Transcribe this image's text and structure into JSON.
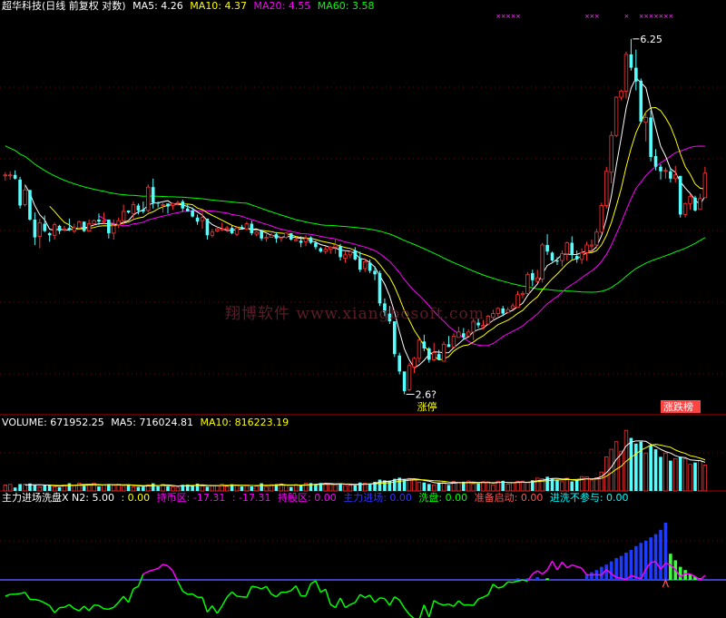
{
  "price_panel": {
    "title": "超华科技(日线 前复权 对数)",
    "legend": [
      {
        "label": "MA5: 4.26",
        "color": "#ffffff"
      },
      {
        "label": "MA10: 4.37",
        "color": "#ffff00"
      },
      {
        "label": "MA20: 4.55",
        "color": "#ff00ff"
      },
      {
        "label": "MA60: 3.58",
        "color": "#00ff00"
      }
    ],
    "high_label": "6.25",
    "low_label": "2.6?",
    "low_tag": "涨停",
    "high_tag": "涨跌榜",
    "watermark": "翔博软件 www.xiangbosoft.com"
  },
  "volume_panel": {
    "legend": [
      {
        "label": "VOLUME: 671952.25",
        "color": "#ffffff"
      },
      {
        "label": "MA5: 716024.81",
        "color": "#ffffff"
      },
      {
        "label": "MA10: 816223.19",
        "color": "#ffff00"
      }
    ]
  },
  "indicator_panel": {
    "legend": [
      {
        "label": "主力进场洗盘X  N2: 5.00",
        "color": "#ffffff"
      },
      {
        "label": ": 0.00",
        "color": "#ffff00"
      },
      {
        "label": "持币区: -17.31",
        "color": "#ff00ff"
      },
      {
        "label": ": -17.31",
        "color": "#ff00ff"
      },
      {
        "label": "持股区: 0.00",
        "color": "#ff00ff"
      },
      {
        "label": "主力进场: 0.00",
        "color": "#3333ff"
      },
      {
        "label": "洗盘: 0.00",
        "color": "#00ff00"
      },
      {
        "label": "准备启动: 0.00",
        "color": "#ff5555"
      },
      {
        "label": "进洗不参与: 0.00",
        "color": "#00ffff"
      }
    ]
  },
  "colors": {
    "up": "#ff3333",
    "down": "#54ffff",
    "ma5": "#ffffff",
    "ma10": "#ffff00",
    "ma20": "#ff00ff",
    "ma60": "#00ff00",
    "grid": "#7a0000",
    "blue_bar": "#1e3cff",
    "green_bar": "#3cff3c"
  },
  "chart_data": {
    "type": "candlestick",
    "scale": "log",
    "y_range": [
      2.55,
      6.6
    ],
    "ohlc": [
      [
        4.49,
        4.53,
        4.44,
        4.5
      ],
      [
        4.5,
        4.54,
        4.45,
        4.5
      ],
      [
        4.5,
        4.55,
        4.45,
        4.46
      ],
      [
        4.45,
        4.48,
        4.15,
        4.18
      ],
      [
        4.19,
        4.38,
        4.17,
        4.34
      ],
      [
        4.34,
        4.34,
        4.03,
        4.04
      ],
      [
        4.04,
        4.11,
        3.8,
        3.87
      ],
      [
        3.88,
        4.05,
        3.77,
        4.01
      ],
      [
        4.0,
        4.08,
        3.92,
        3.93
      ],
      [
        3.91,
        3.92,
        3.83,
        3.89
      ],
      [
        3.89,
        4.01,
        3.85,
        3.99
      ],
      [
        3.98,
        3.99,
        3.9,
        3.93
      ],
      [
        3.94,
        3.98,
        3.93,
        3.95
      ],
      [
        3.96,
        4.05,
        3.93,
        3.94
      ],
      [
        3.93,
        4.0,
        3.91,
        3.96
      ],
      [
        3.96,
        4.03,
        3.95,
        4.02
      ],
      [
        4.02,
        4.02,
        3.92,
        3.93
      ],
      [
        3.93,
        4.04,
        3.93,
        4.0
      ],
      [
        4.0,
        4.04,
        3.98,
        4.03
      ],
      [
        4.04,
        4.1,
        3.99,
        4.02
      ],
      [
        4.02,
        4.11,
        4.0,
        4.03
      ],
      [
        4.04,
        4.04,
        3.86,
        3.91
      ],
      [
        3.91,
        4.04,
        3.85,
        3.98
      ],
      [
        3.99,
        4.06,
        3.96,
        4.03
      ],
      [
        4.03,
        4.19,
        3.99,
        4.12
      ],
      [
        4.13,
        4.13,
        4.1,
        4.11
      ],
      [
        4.1,
        4.22,
        4.05,
        4.19
      ],
      [
        4.18,
        4.2,
        4.09,
        4.13
      ],
      [
        4.14,
        4.22,
        4.1,
        4.12
      ],
      [
        4.13,
        4.4,
        4.11,
        4.37
      ],
      [
        4.37,
        4.46,
        4.15,
        4.21
      ],
      [
        4.21,
        4.22,
        4.16,
        4.2
      ],
      [
        4.19,
        4.23,
        4.11,
        4.19
      ],
      [
        4.2,
        4.2,
        4.1,
        4.17
      ],
      [
        4.18,
        4.21,
        4.14,
        4.2
      ],
      [
        4.2,
        4.23,
        4.18,
        4.21
      ],
      [
        4.22,
        4.24,
        4.12,
        4.15
      ],
      [
        4.15,
        4.19,
        4.12,
        4.12
      ],
      [
        4.13,
        4.16,
        4.06,
        4.07
      ],
      [
        4.06,
        4.09,
        3.99,
        4.02
      ],
      [
        4.03,
        4.11,
        3.95,
        4.06
      ],
      [
        4.05,
        4.05,
        3.85,
        3.89
      ],
      [
        3.89,
        3.95,
        3.87,
        3.92
      ],
      [
        3.93,
        3.98,
        3.92,
        3.95
      ],
      [
        3.95,
        4.01,
        3.93,
        3.95
      ],
      [
        3.95,
        3.98,
        3.92,
        3.96
      ],
      [
        3.96,
        3.99,
        3.9,
        3.91
      ],
      [
        3.9,
        3.97,
        3.88,
        3.96
      ],
      [
        3.97,
        3.99,
        3.95,
        3.96
      ],
      [
        3.95,
        4.02,
        3.94,
        4.0
      ],
      [
        4.0,
        4.03,
        3.89,
        3.91
      ],
      [
        3.9,
        3.93,
        3.88,
        3.92
      ],
      [
        3.93,
        3.94,
        3.84,
        3.86
      ],
      [
        3.86,
        3.9,
        3.83,
        3.87
      ],
      [
        3.87,
        3.91,
        3.87,
        3.89
      ],
      [
        3.9,
        3.92,
        3.82,
        3.86
      ],
      [
        3.86,
        3.87,
        3.83,
        3.87
      ],
      [
        3.87,
        3.92,
        3.86,
        3.91
      ],
      [
        3.91,
        3.91,
        3.84,
        3.85
      ],
      [
        3.84,
        3.87,
        3.83,
        3.85
      ],
      [
        3.84,
        3.88,
        3.78,
        3.82
      ],
      [
        3.83,
        3.89,
        3.79,
        3.86
      ],
      [
        3.87,
        3.88,
        3.81,
        3.82
      ],
      [
        3.82,
        3.84,
        3.76,
        3.78
      ],
      [
        3.77,
        3.78,
        3.73,
        3.74
      ],
      [
        3.74,
        3.79,
        3.72,
        3.76
      ],
      [
        3.76,
        3.79,
        3.72,
        3.78
      ],
      [
        3.78,
        3.85,
        3.72,
        3.8
      ],
      [
        3.79,
        3.81,
        3.66,
        3.69
      ],
      [
        3.68,
        3.74,
        3.64,
        3.71
      ],
      [
        3.71,
        3.75,
        3.68,
        3.74
      ],
      [
        3.75,
        3.78,
        3.66,
        3.67
      ],
      [
        3.68,
        3.74,
        3.56,
        3.58
      ],
      [
        3.59,
        3.68,
        3.56,
        3.65
      ],
      [
        3.64,
        3.67,
        3.55,
        3.57
      ],
      [
        3.57,
        3.61,
        3.49,
        3.54
      ],
      [
        3.55,
        3.57,
        3.28,
        3.3
      ],
      [
        3.3,
        3.34,
        3.2,
        3.23
      ],
      [
        3.22,
        3.28,
        3.14,
        3.16
      ],
      [
        3.16,
        3.16,
        2.9,
        2.92
      ],
      [
        2.91,
        2.93,
        2.78,
        2.8
      ],
      [
        2.8,
        2.8,
        2.65,
        2.67
      ],
      [
        2.68,
        2.86,
        2.67,
        2.84
      ],
      [
        2.83,
        2.9,
        2.79,
        2.89
      ],
      [
        2.89,
        3.03,
        2.86,
        3.02
      ],
      [
        3.01,
        3.06,
        2.94,
        2.96
      ],
      [
        2.96,
        2.97,
        2.86,
        2.88
      ],
      [
        2.88,
        3.0,
        2.87,
        2.93
      ],
      [
        2.92,
        2.95,
        2.88,
        2.88
      ],
      [
        2.87,
        3.01,
        2.87,
        2.99
      ],
      [
        2.99,
        3.05,
        2.97,
        2.97
      ],
      [
        2.97,
        3.07,
        2.97,
        3.05
      ],
      [
        3.04,
        3.12,
        3.04,
        3.08
      ],
      [
        3.07,
        3.11,
        3.02,
        3.04
      ],
      [
        3.05,
        3.1,
        3.05,
        3.08
      ],
      [
        3.08,
        3.18,
        3.02,
        3.16
      ],
      [
        3.15,
        3.18,
        3.11,
        3.13
      ],
      [
        3.12,
        3.17,
        3.1,
        3.13
      ],
      [
        3.14,
        3.21,
        3.13,
        3.2
      ],
      [
        3.19,
        3.25,
        3.16,
        3.22
      ],
      [
        3.22,
        3.27,
        3.2,
        3.26
      ],
      [
        3.26,
        3.28,
        3.2,
        3.22
      ],
      [
        3.23,
        3.27,
        3.22,
        3.25
      ],
      [
        3.26,
        3.3,
        3.25,
        3.28
      ],
      [
        3.27,
        3.4,
        3.27,
        3.37
      ],
      [
        3.37,
        3.4,
        3.34,
        3.38
      ],
      [
        3.38,
        3.56,
        3.37,
        3.54
      ],
      [
        3.55,
        3.58,
        3.44,
        3.49
      ],
      [
        3.48,
        3.58,
        3.47,
        3.51
      ],
      [
        3.5,
        3.82,
        3.47,
        3.8
      ],
      [
        3.8,
        3.9,
        3.71,
        3.74
      ],
      [
        3.73,
        3.74,
        3.65,
        3.66
      ],
      [
        3.66,
        3.69,
        3.62,
        3.65
      ],
      [
        3.66,
        3.75,
        3.61,
        3.72
      ],
      [
        3.72,
        3.83,
        3.66,
        3.82
      ],
      [
        3.82,
        3.88,
        3.67,
        3.71
      ],
      [
        3.7,
        3.75,
        3.64,
        3.67
      ],
      [
        3.67,
        3.77,
        3.63,
        3.73
      ],
      [
        3.73,
        3.83,
        3.66,
        3.8
      ],
      [
        3.79,
        3.85,
        3.74,
        3.8
      ],
      [
        3.8,
        3.95,
        3.77,
        3.92
      ],
      [
        3.92,
        4.21,
        3.91,
        4.18
      ],
      [
        4.18,
        4.59,
        4.15,
        4.54
      ],
      [
        4.53,
        5.0,
        4.41,
        4.95
      ],
      [
        4.95,
        5.44,
        4.93,
        5.43
      ],
      [
        5.43,
        5.53,
        5.39,
        5.51
      ],
      [
        5.51,
        6.06,
        5.41,
        6.02
      ],
      [
        6.02,
        6.25,
        5.79,
        5.83
      ],
      [
        5.83,
        6.09,
        5.52,
        5.64
      ],
      [
        5.65,
        5.68,
        5.1,
        5.12
      ],
      [
        5.11,
        5.24,
        4.88,
        5.17
      ],
      [
        5.17,
        5.26,
        4.65,
        4.7
      ],
      [
        4.71,
        4.79,
        4.55,
        4.59
      ],
      [
        4.59,
        4.62,
        4.45,
        4.54
      ],
      [
        4.54,
        4.58,
        4.46,
        4.55
      ],
      [
        4.54,
        4.58,
        4.42,
        4.46
      ],
      [
        4.46,
        4.6,
        4.42,
        4.5
      ],
      [
        4.49,
        4.49,
        4.06,
        4.09
      ],
      [
        4.09,
        4.21,
        4.06,
        4.2
      ],
      [
        4.2,
        4.3,
        4.14,
        4.27
      ],
      [
        4.26,
        4.28,
        4.12,
        4.13
      ],
      [
        4.14,
        4.3,
        4.14,
        4.25
      ],
      [
        4.26,
        4.59,
        4.26,
        4.52
      ]
    ],
    "volume": [
      157853,
      172217,
      90606,
      182108,
      180018,
      197011,
      151981,
      111187,
      150159,
      167932,
      113289,
      97736,
      152484,
      202022,
      155014,
      208719,
      136014,
      168004,
      206016,
      119089,
      160620,
      182187,
      149081,
      178081,
      125785,
      171289,
      106432,
      108227,
      111436,
      161853,
      200710,
      125398,
      179407,
      120643,
      106281,
      95213,
      163575,
      170998,
      137810,
      193355,
      130549,
      112811,
      147633,
      138713,
      177347,
      121657,
      176913,
      153416,
      121216,
      156312,
      119562,
      129883,
      201716,
      117934,
      166585,
      179183,
      186104,
      152542,
      104914,
      169237,
      144082,
      200123,
      207512,
      165627,
      209658,
      202810,
      183458,
      165779,
      202016,
      146286,
      146612,
      144210,
      222201,
      206356,
      196521,
      241519,
      300000,
      280000,
      270000,
      320000,
      350000,
      300000,
      330000,
      309744,
      230707,
      222911,
      183111,
      163522,
      223282,
      232520,
      156931,
      247587,
      232736,
      243536,
      261436,
      188286,
      197815,
      244893,
      238616,
      163599,
      257616,
      267283,
      178856,
      216059,
      250000,
      260000,
      220000,
      282140,
      338062,
      322838,
      375211,
      334213,
      294116,
      243547,
      334838,
      251566,
      275089,
      379013,
      373624,
      291522,
      350000,
      500000,
      900000,
      1100000,
      1300000,
      1050000,
      1600000,
      1400000,
      1250000,
      1300000,
      1000000,
      1200000,
      1100000,
      900000,
      1000000,
      800000,
      850000,
      900000,
      850000,
      700000,
      750000,
      800000,
      680000
    ],
    "indicator": [
      -6.0,
      -5.32,
      -5.24,
      -5.06,
      -4.58,
      -7.16,
      -7.22,
      -7.58,
      -8.47,
      -9.45,
      -12.08,
      -10.22,
      -10.04,
      -9.08,
      -10.58,
      -11.34,
      -9.65,
      -11.3,
      -9.24,
      -9.43,
      -10.61,
      -10.75,
      -10.09,
      -8.22,
      -6.05,
      -8.26,
      -3.28,
      -2.37,
      2.12,
      3.08,
      3.65,
      4.16,
      5.72,
      5.12,
      3.28,
      -0.52,
      -4.14,
      -5.31,
      -5.18,
      -6.39,
      -6.4,
      -11.82,
      -9.49,
      -12.29,
      -9.56,
      -6.31,
      -4.45,
      -5.98,
      -6.21,
      -6.38,
      -2.38,
      -2.65,
      -3.3,
      -2.41,
      -5.24,
      -6.2,
      -4.53,
      -4.56,
      -3.93,
      -2.19,
      -5.91,
      -5.86,
      -1.42,
      -0.35,
      -4.56,
      -3.4,
      -9.06,
      -10.18,
      -6.64,
      -10.18,
      -9.08,
      -8.33,
      -5.38,
      -6.51,
      -5.62,
      -8.29,
      -6.6,
      -6.88,
      -9.32,
      -6.2,
      -7.43,
      -10.36,
      -12.67,
      -14.26,
      -14.68,
      -9.16,
      -13.65,
      -7.59,
      -8.72,
      -9.25,
      -8.9,
      -9.75,
      -7.7,
      -9.22,
      -9.16,
      -9.38,
      -7.02,
      -6.37,
      -5.44,
      -1.58,
      -2.99,
      -2.53,
      -0.74,
      -0.92,
      -0.41,
      -0.04,
      -0.45,
      2.19,
      3.33,
      2.16,
      3.67,
      6.93,
      3.69,
      6.56,
      4.44,
      5.45,
      4.92,
      4.26,
      1.82,
      1.85,
      1.93,
      1.8,
      3.82,
      2.21,
      0.95,
      0.57,
      0.14,
      1.53,
      1.05,
      0.33,
      3.95,
      6.44,
      6.68,
      3.91,
      6.09,
      5.51,
      3.78,
      1.05,
      2.31,
      2.16,
      1.24,
      -0.06,
      1.67
    ],
    "bars_blue": [
      [
        104,
        3
      ],
      [
        106,
        3
      ],
      [
        108,
        5
      ],
      [
        118,
        10
      ],
      [
        119,
        14
      ],
      [
        120,
        18
      ],
      [
        121,
        24
      ],
      [
        122,
        28
      ],
      [
        123,
        34
      ],
      [
        124,
        40
      ],
      [
        125,
        44
      ],
      [
        126,
        50
      ],
      [
        127,
        55
      ],
      [
        128,
        62
      ],
      [
        129,
        68
      ],
      [
        130,
        72
      ],
      [
        131,
        78
      ],
      [
        132,
        84
      ],
      [
        133,
        92
      ],
      [
        134,
        105
      ]
    ],
    "bars_green": [
      [
        110,
        3
      ],
      [
        135,
        48
      ],
      [
        136,
        36
      ],
      [
        137,
        24
      ],
      [
        138,
        18
      ],
      [
        139,
        10
      ],
      [
        140,
        6
      ],
      [
        141,
        3
      ]
    ]
  }
}
